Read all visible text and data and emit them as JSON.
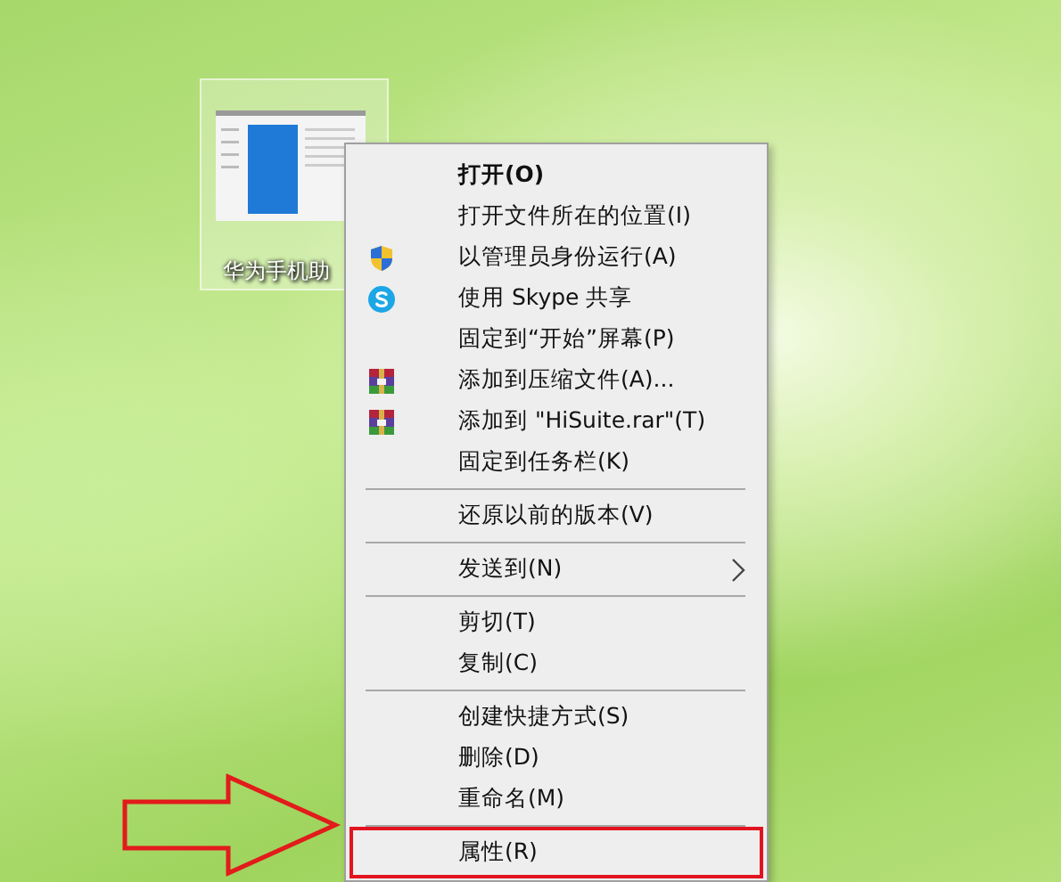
{
  "desktop_icon": {
    "label": "华为手机助",
    "selected": true
  },
  "context_menu": {
    "items": [
      {
        "kind": "default",
        "label": "打开(O)"
      },
      {
        "kind": "plain",
        "label": "打开文件所在的位置(I)"
      },
      {
        "kind": "admin",
        "label": "以管理员身份运行(A)"
      },
      {
        "kind": "share",
        "label": "使用 Skype 共享"
      },
      {
        "kind": "plain",
        "label": "固定到“开始”屏幕(P)"
      },
      {
        "kind": "archive",
        "label": "添加到压缩文件(A)..."
      },
      {
        "kind": "archive",
        "label": "添加到 \"HiSuite.rar\"(T)"
      },
      {
        "kind": "plain",
        "label": "固定到任务栏(K)"
      },
      {
        "kind": "separator"
      },
      {
        "kind": "plain",
        "label": "还原以前的版本(V)"
      },
      {
        "kind": "separator"
      },
      {
        "kind": "submenu",
        "label": "发送到(N)"
      },
      {
        "kind": "separator"
      },
      {
        "kind": "plain",
        "label": "剪切(T)"
      },
      {
        "kind": "plain",
        "label": "复制(C)"
      },
      {
        "kind": "separator"
      },
      {
        "kind": "plain",
        "label": "创建快捷方式(S)"
      },
      {
        "kind": "plain",
        "label": "删除(D)"
      },
      {
        "kind": "plain",
        "label": "重命名(M)"
      },
      {
        "kind": "separator"
      },
      {
        "kind": "plain",
        "label": "属性(R)",
        "highlighted": true
      }
    ]
  }
}
